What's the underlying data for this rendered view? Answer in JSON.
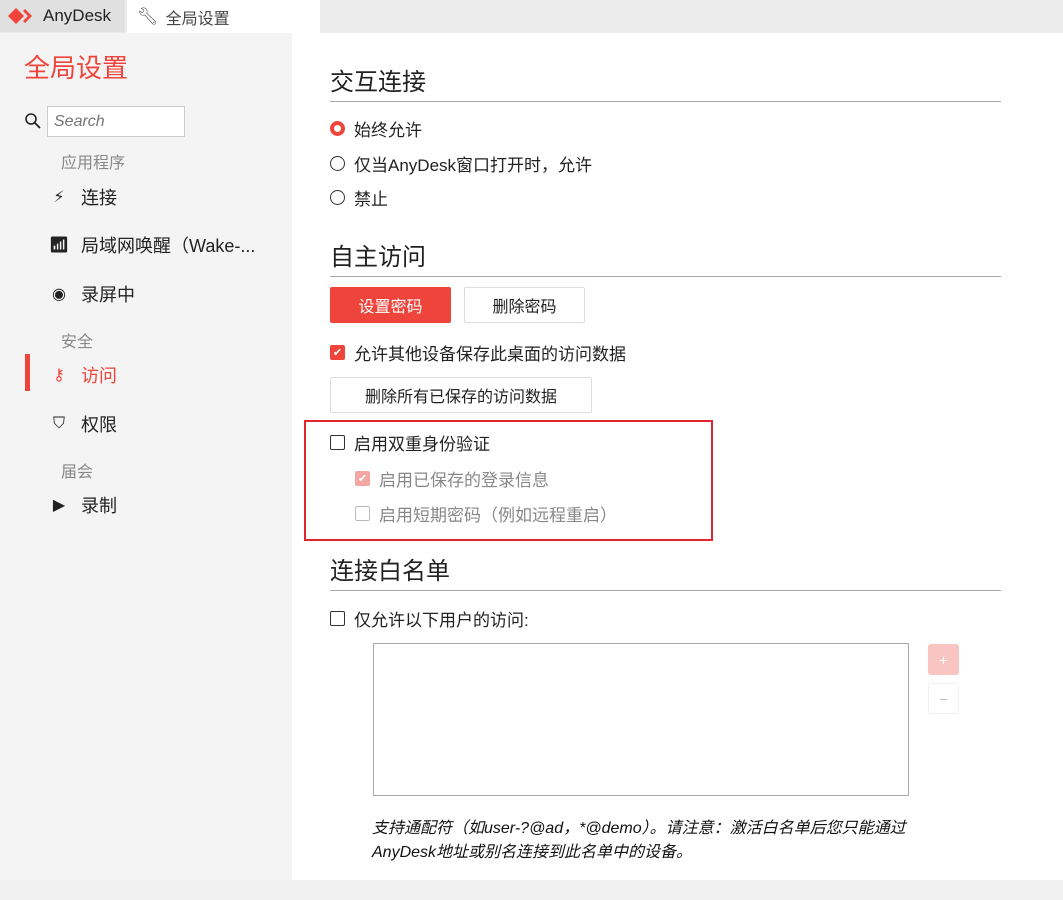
{
  "titlebar": {
    "app_name": "AnyDesk",
    "tab_title": "全局设置"
  },
  "sidebar": {
    "title": "全局设置",
    "search_placeholder": "Search",
    "groups": [
      {
        "label": "应用程序",
        "items": [
          {
            "label": "连接",
            "icon": "connection-icon"
          },
          {
            "label": "局域网唤醒（Wake-...",
            "icon": "wake-on-lan-icon"
          },
          {
            "label": "录屏中",
            "icon": "record-icon"
          }
        ]
      },
      {
        "label": "安全",
        "items": [
          {
            "label": "访问",
            "icon": "key-icon",
            "active": true
          },
          {
            "label": "权限",
            "icon": "shield-icon"
          }
        ]
      },
      {
        "label": "届会",
        "items": [
          {
            "label": "录制",
            "icon": "screen-play-icon"
          }
        ]
      }
    ]
  },
  "main": {
    "interactive": {
      "heading": "交互连接",
      "options": [
        "始终允许",
        "仅当AnyDesk窗口打开时，允许",
        "禁止"
      ],
      "selected": 0
    },
    "unattended": {
      "heading": "自主访问",
      "set_password": "设置密码",
      "delete_password": "删除密码",
      "allow_save_label": "允许其他设备保存此桌面的访问数据",
      "allow_save_checked": true,
      "delete_all_saved": "删除所有已保存的访问数据"
    },
    "two_factor": {
      "label": "启用双重身份验证",
      "checked": false,
      "sub": [
        {
          "label": "启用已保存的登录信息",
          "checked": true
        },
        {
          "label": "启用短期密码（例如远程重启）",
          "checked": false
        }
      ]
    },
    "whitelist": {
      "heading": "连接白名单",
      "only_allow_label": "仅允许以下用户的访问:",
      "checked": false,
      "add": "+",
      "remove": "−",
      "note_line1": "支持通配符（如user-?@ad，*@demo）。请注意：激活白名单后您只能通过",
      "note_line2": "AnyDesk地址或别名连接到此名单中的设备。"
    }
  },
  "colors": {
    "accent": "#ef443b",
    "highlight_box": "#e0262f"
  }
}
